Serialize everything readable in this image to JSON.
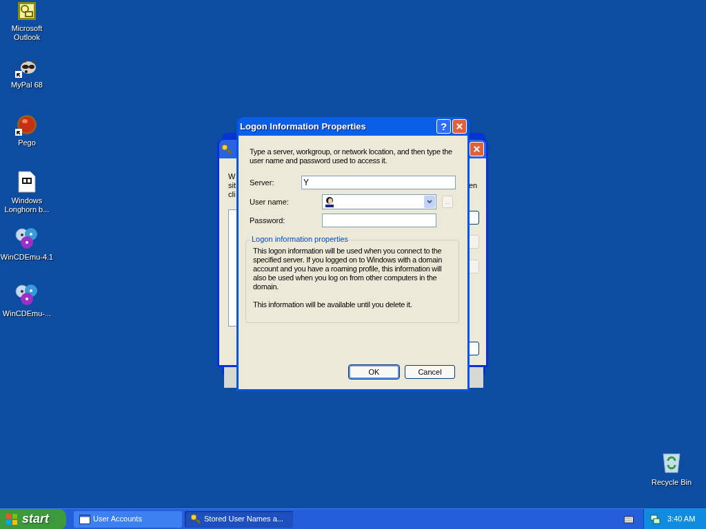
{
  "desktop": {
    "icons": [
      {
        "label": "Microsoft Outlook",
        "shortcut": false
      },
      {
        "label": "MyPal 68",
        "shortcut": true
      },
      {
        "label": "Pego",
        "shortcut": true
      },
      {
        "label": "Windows Longhorn b...",
        "shortcut": false
      },
      {
        "label": "WinCDEmu-4.1",
        "shortcut": false
      },
      {
        "label": "WinCDEmu-...",
        "shortcut": false
      }
    ],
    "recycle_bin": {
      "label": "Recycle Bin"
    }
  },
  "back_window": {
    "text_left": [
      "W",
      "sit",
      "cli"
    ],
    "text_right": "en"
  },
  "dialog": {
    "title": "Logon Information Properties",
    "help": "?",
    "intro": "Type a server, workgroup, or network location, and then type the user name and password used to access it.",
    "fields": [
      {
        "kind": "text",
        "label": "Server:",
        "value": "Y"
      },
      {
        "kind": "combo",
        "label": "User name:",
        "browse": "...",
        "browse_disabled": true
      },
      {
        "kind": "password",
        "label": "Password:"
      }
    ],
    "group": {
      "title": "Logon information properties",
      "paragraphs": [
        "This logon information will be used when you connect to the specified server. If you logged on to Windows with a domain account and you have a roaming profile, this information will also be used when you log on from other computers in the domain.",
        "This information will be available until you delete it."
      ]
    },
    "buttons": [
      {
        "label": "OK",
        "default": true
      },
      {
        "label": "Cancel",
        "default": false
      }
    ]
  },
  "taskbar": {
    "start": "start",
    "tasks": [
      {
        "label": "User Accounts",
        "selected": false
      },
      {
        "label": "Stored User Names a...",
        "selected": true
      }
    ],
    "clock": "3:40 AM"
  }
}
